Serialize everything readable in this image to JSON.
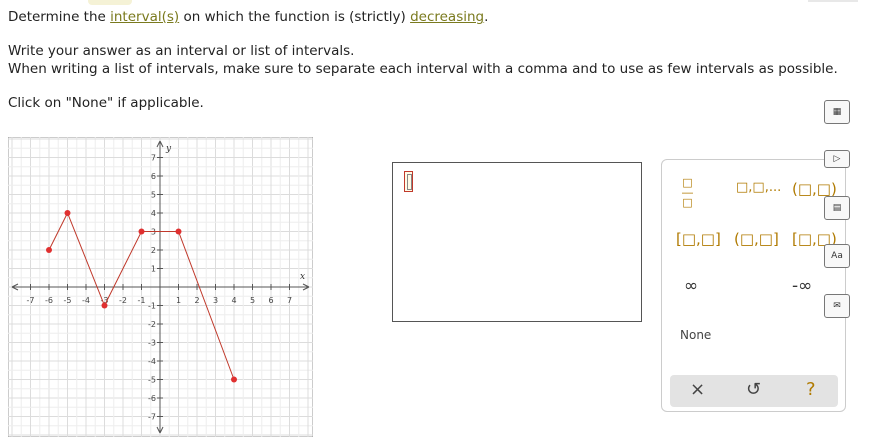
{
  "question": {
    "line1_pre": "Determine the ",
    "line1_link1": "interval(s)",
    "line1_mid": " on which the function is (strictly) ",
    "line1_link2": "decreasing",
    "line1_post": ".",
    "line2": "Write your answer as an interval or list of intervals.",
    "line3": "When writing a list of intervals, make sure to separate each interval with a comma and to use as few intervals as possible.",
    "line4": "Click on \"None\" if applicable."
  },
  "graph": {
    "x_label": "x",
    "y_label": "y",
    "x_ticks": [
      "-7",
      "-6",
      "-5",
      "-4",
      "-3",
      "-2",
      "-1",
      "1",
      "2",
      "3",
      "4",
      "5",
      "6",
      "7"
    ],
    "y_ticks": [
      "7",
      "6",
      "5",
      "4",
      "3",
      "2",
      "1",
      "-1",
      "-2",
      "-3",
      "-4",
      "-5",
      "-6",
      "-7"
    ],
    "xlim": [
      -7,
      7
    ],
    "ylim": [
      -7,
      7
    ],
    "points": [
      [
        -6,
        2
      ],
      [
        -5,
        4
      ],
      [
        -3,
        -1
      ],
      [
        -1,
        3
      ],
      [
        1,
        3
      ],
      [
        4,
        -5
      ]
    ],
    "line_color": "#c0392b",
    "point_color": "#e03030"
  },
  "palette": {
    "accent": "#b07a00",
    "none_label": "None",
    "infinity": "∞",
    "neg_infinity": "-∞",
    "clear_symbol": "×",
    "undo_symbol": "↺",
    "help_symbol": "?",
    "intervals": {
      "list": "□,□,...",
      "open_open": "(□,□)",
      "closed_closed": "[□,□]",
      "open_closed": "(□,□]",
      "closed_open": "[□,□)"
    }
  },
  "side_icons": [
    "calculator-icon",
    "play-icon",
    "sheet-icon",
    "text-icon",
    "mail-icon"
  ],
  "side_labels": {
    "text": "Aa"
  }
}
